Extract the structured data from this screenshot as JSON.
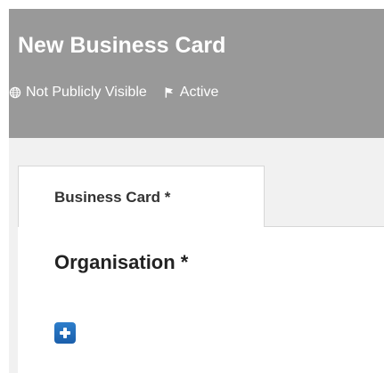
{
  "header": {
    "title": "New Business Card",
    "visibility": {
      "label": "Not Publicly Visible",
      "icon": "globe-icon"
    },
    "status": {
      "label": "Active",
      "icon": "flag-icon"
    }
  },
  "tabs": [
    {
      "label": "Business Card *",
      "active": true
    }
  ],
  "form": {
    "section_title": "Organisation *",
    "add_button": {
      "icon": "plus-icon"
    }
  },
  "colors": {
    "header_background": "#999999",
    "page_background": "#f1f1f1",
    "button_blue": "#2d7ecb"
  }
}
